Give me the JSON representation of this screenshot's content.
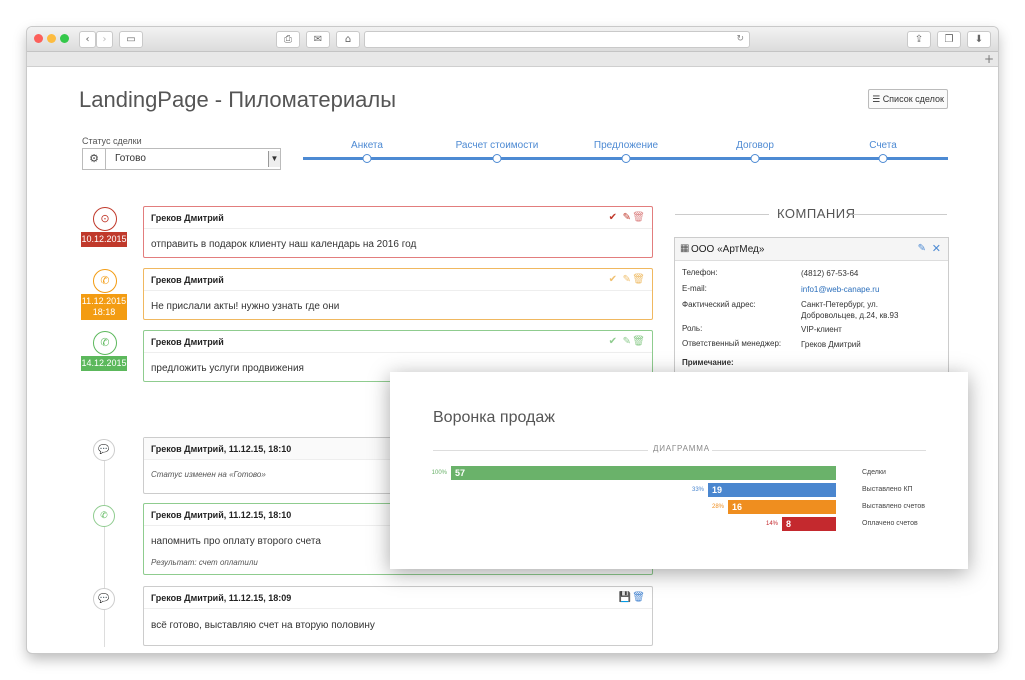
{
  "page_title": "LandingPage - Пиломатериалы",
  "deals_list_button": "Список сделок",
  "status": {
    "label": "Статус сделки",
    "value": "Готово"
  },
  "stages": [
    "Анкета",
    "Расчет стоимости",
    "Предложение",
    "Договор",
    "Счета"
  ],
  "tasks": [
    {
      "author": "Греков Дмитрий",
      "text": "отправить в подарок клиенту наш календарь на 2016 год",
      "date": "10.12.2015",
      "time": "",
      "color": "#c0392b",
      "icon": "clock-icon"
    },
    {
      "author": "Греков Дмитрий",
      "text": "Не прислали акты! нужно узнать где они",
      "date": "11.12.2015",
      "time": "18:18",
      "color": "#f39c12",
      "icon": "phone-icon"
    },
    {
      "author": "Греков Дмитрий",
      "text": "предложить услуги продвижения",
      "date": "14.12.2015",
      "time": "",
      "color": "#5cb85c",
      "icon": "phone-icon"
    }
  ],
  "company": {
    "heading": "КОМПАНИЯ",
    "name": "ООО «АртМед»",
    "phone_label": "Телефон:",
    "phone": "(4812) 67-53-64",
    "email_label": "E-mail:",
    "email": "info1@web-canape.ru",
    "address_label": "Фактический адрес:",
    "address_line1": "Санкт-Петербург, ул.",
    "address_line2": "Добровольцев, д.24, кв.93",
    "role_label": "Роль:",
    "role": "VIP-клиент",
    "manager_label": "Ответственный менеджер:",
    "manager": "Греков Дмитрий",
    "note_label": "Примечание:"
  },
  "history": [
    {
      "author": "Греков Дмитрий, 11.12.15, 18:10",
      "text": "Статус изменен на «Готово»",
      "result": "",
      "icon": "comment-icon"
    },
    {
      "author": "Греков Дмитрий, 11.12.15, 18:10",
      "text": "напомнить про оплату второго счета",
      "result": "Результат: счет оплатили",
      "icon": "phone-icon"
    },
    {
      "author": "Греков Дмитрий, 11.12.15, 18:09",
      "text": "всё готово, выставляю счет на вторую половину",
      "result": "",
      "icon": "comment-icon"
    }
  ],
  "funnel": {
    "title": "Воронка продаж",
    "section_label": "ДИАГРАММА"
  },
  "chart_data": {
    "type": "bar",
    "orientation": "horizontal-funnel",
    "categories": [
      "Сделки",
      "Выставлено КП",
      "Выставлено счетов",
      "Оплачено счетов"
    ],
    "values": [
      57,
      19,
      16,
      8
    ],
    "percent_labels": [
      "100%",
      "33%",
      "28%",
      "14%"
    ],
    "colors": [
      "#6ab26a",
      "#4a86cf",
      "#ef8e1f",
      "#c4292e"
    ],
    "title": "Воронка продаж",
    "xlabel": "",
    "ylabel": "",
    "xlim": [
      0,
      57
    ],
    "grid": false
  }
}
